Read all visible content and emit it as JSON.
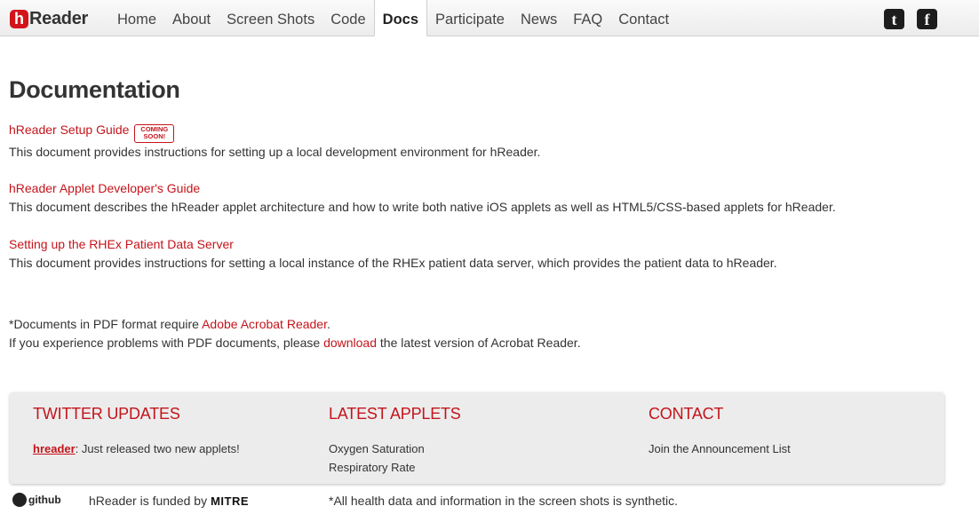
{
  "brand": {
    "mark": "h",
    "name": "Reader"
  },
  "nav": [
    "Home",
    "About",
    "Screen Shots",
    "Code",
    "Docs",
    "Participate",
    "News",
    "FAQ",
    "Contact"
  ],
  "social": {
    "twitter_glyph": "t",
    "facebook_glyph": "f"
  },
  "main": {
    "title": "Documentation",
    "docs": [
      {
        "link": "hReader Setup Guide",
        "badge_line1": "COMING",
        "badge_line2": "SOON!",
        "desc": "This document provides instructions for setting up a local development environment for hReader."
      },
      {
        "link": "hReader Applet Developer's Guide",
        "desc": "This document describes the hReader applet architecture and how to write both native iOS applets as well as HTML5/CSS-based applets for hReader."
      },
      {
        "link": "Setting up the RHEx Patient Data Server",
        "desc": "This document provides instructions for setting a local instance of the RHEx patient data server, which provides the patient data to hReader."
      }
    ],
    "note1_prefix": "*Documents in PDF format require ",
    "note1_link": "Adobe Acrobat Reader",
    "note1_suffix": ".",
    "note2_prefix": "If you experience problems with PDF documents, please ",
    "note2_link": "download",
    "note2_suffix": " the latest version of Acrobat Reader."
  },
  "footer": {
    "twitter": {
      "heading": "TWITTER UPDATES",
      "handle": "hreader",
      "text": ": Just released two new applets!"
    },
    "applets": {
      "heading": "LATEST APPLETS",
      "items": [
        "Oxygen Saturation",
        "Respiratory Rate"
      ]
    },
    "contact": {
      "heading": "CONTACT",
      "item": "Join the Announcement List"
    },
    "github_label": "github",
    "funded_by": "hReader is funded by",
    "sponsor": "MITRE",
    "disclaimer": "*All health data and information in the screen shots is synthetic."
  },
  "colors": {
    "accent": "#c4141b",
    "brand": "#d2141a",
    "panel": "#ececec"
  }
}
